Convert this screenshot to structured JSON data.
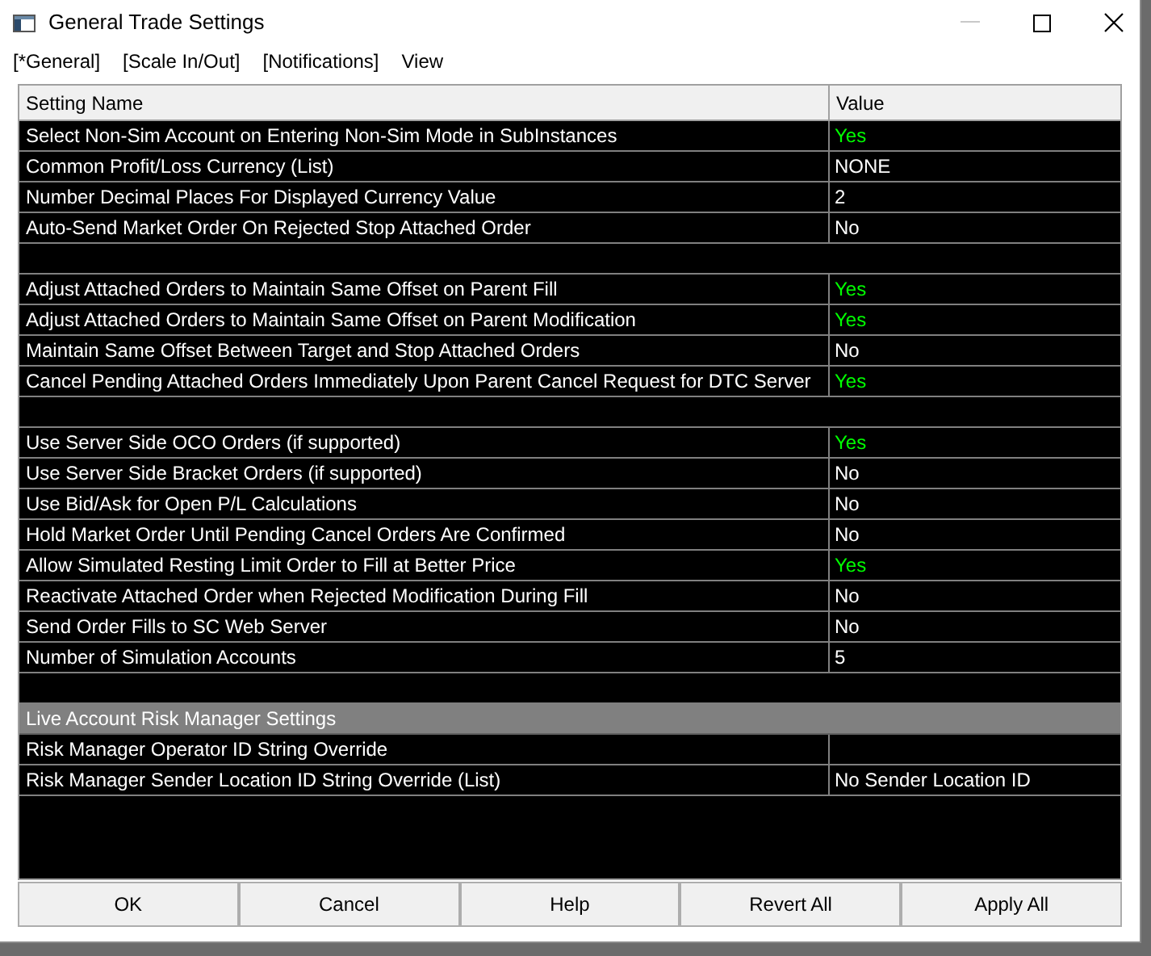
{
  "window": {
    "title": "General Trade Settings"
  },
  "menu": [
    {
      "label": "[*General]"
    },
    {
      "label": "[Scale In/Out]"
    },
    {
      "label": "[Notifications]"
    },
    {
      "label": "View"
    }
  ],
  "table": {
    "columns": [
      "Setting Name",
      "Value"
    ],
    "rows": [
      {
        "kind": "setting",
        "name": "Select Non-Sim Account on Entering Non-Sim Mode in SubInstances",
        "value": "Yes",
        "highlighted": true
      },
      {
        "kind": "setting",
        "name": "Common Profit/Loss Currency (List)",
        "value": "NONE",
        "highlighted": false
      },
      {
        "kind": "setting",
        "name": "Number Decimal Places For Displayed Currency Value",
        "value": "2",
        "highlighted": false
      },
      {
        "kind": "setting",
        "name": "Auto-Send Market Order On Rejected Stop Attached Order",
        "value": "No",
        "highlighted": false
      },
      {
        "kind": "spacer"
      },
      {
        "kind": "setting",
        "name": "Adjust Attached Orders to Maintain Same Offset on Parent Fill",
        "value": "Yes",
        "highlighted": true
      },
      {
        "kind": "setting",
        "name": "Adjust Attached Orders to Maintain Same Offset on Parent Modification",
        "value": "Yes",
        "highlighted": true
      },
      {
        "kind": "setting",
        "name": "Maintain Same Offset Between Target and Stop Attached Orders",
        "value": "No",
        "highlighted": false
      },
      {
        "kind": "setting",
        "name": "Cancel Pending Attached Orders Immediately Upon Parent Cancel Request for DTC Server",
        "value": "Yes",
        "highlighted": true
      },
      {
        "kind": "spacer"
      },
      {
        "kind": "setting",
        "name": "Use Server Side OCO Orders (if supported)",
        "value": "Yes",
        "highlighted": true
      },
      {
        "kind": "setting",
        "name": "Use Server Side Bracket Orders (if supported)",
        "value": "No",
        "highlighted": false
      },
      {
        "kind": "setting",
        "name": "Use Bid/Ask for Open P/L Calculations",
        "value": "No",
        "highlighted": false
      },
      {
        "kind": "setting",
        "name": "Hold Market Order Until Pending Cancel Orders Are Confirmed",
        "value": "No",
        "highlighted": false
      },
      {
        "kind": "setting",
        "name": "Allow Simulated Resting Limit Order to Fill at Better Price",
        "value": "Yes",
        "highlighted": true
      },
      {
        "kind": "setting",
        "name": "Reactivate Attached Order when Rejected Modification During Fill",
        "value": "No",
        "highlighted": false
      },
      {
        "kind": "setting",
        "name": "Send Order Fills to SC Web Server",
        "value": "No",
        "highlighted": false
      },
      {
        "kind": "setting",
        "name": "Number of Simulation Accounts",
        "value": "5",
        "highlighted": false
      },
      {
        "kind": "spacer"
      },
      {
        "kind": "section",
        "name": "Live Account Risk Manager Settings"
      },
      {
        "kind": "setting",
        "name": "Risk Manager Operator ID String Override"
      },
      {
        "kind": "setting",
        "name": "Risk Manager Sender Location ID String Override (List)",
        "value": "No Sender Location ID",
        "highlighted": false
      }
    ]
  },
  "buttons": [
    "OK",
    "Cancel",
    "Help",
    "Revert All",
    "Apply All"
  ]
}
